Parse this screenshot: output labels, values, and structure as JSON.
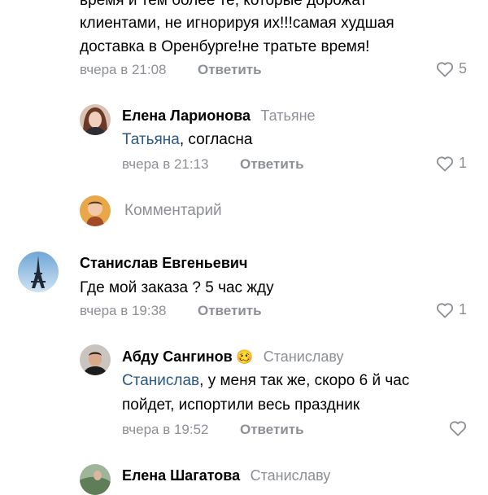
{
  "comment_top": {
    "lines": [
      "время и тем более те, которые дорожат",
      "клиентами, не игнорируя их!!!самая худшая",
      "доставка в Оренбурге!не тратьте время!"
    ],
    "time": "вчера в 21:08",
    "reply_label": "Ответить",
    "likes": "5"
  },
  "reply_1": {
    "author": "Елена Ларионова",
    "reply_to": "Татьяне",
    "mention": "Татьяна",
    "text": ", согласна",
    "time": "вчера в 21:13",
    "reply_label": "Ответить",
    "likes": "1"
  },
  "comment_input": {
    "placeholder": "Комментарий"
  },
  "comment_2": {
    "author": "Станислав Евгеньевич",
    "text": "Где мой заказа ? 5 час жду",
    "time": "вчера в 19:38",
    "reply_label": "Ответить",
    "likes": "1"
  },
  "reply_2": {
    "author": "Абду Сангинов",
    "emoji": "🥴",
    "reply_to": "Станиславу",
    "mention": "Станислав",
    "text_line1": ", у меня так же, скоро 6 й час",
    "text_line2": "пойдет, испортили весь праздник",
    "time": "вчера в 19:52",
    "reply_label": "Ответить"
  },
  "reply_3": {
    "author": "Елена Шагатова",
    "reply_to": "Станиславу"
  }
}
